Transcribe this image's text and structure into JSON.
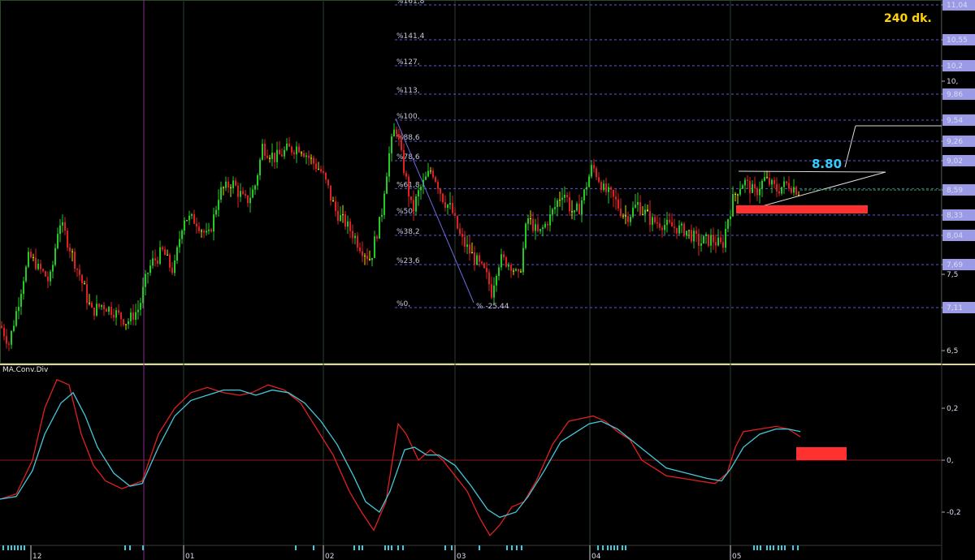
{
  "timeframe_label": "240 dk.",
  "indicator_title": "MA.Conv.Div",
  "annotation_value": "8.80",
  "fib_low_label": "% -25.44",
  "colors": {
    "background": "#000000",
    "up_candle": "#22cc22",
    "down_candle": "#e02020",
    "doji": "#e0e000",
    "fib_line": "#5a5ad8",
    "macd_line": "#e02020",
    "signal_line": "#44c8dc",
    "highlight_box": "#ff3030",
    "axis_label_bg": "#9a9ae6",
    "current_price_line": "#22bb22",
    "timeframe": "#ffd400",
    "annotation": "#33ccff"
  },
  "chart_data": [
    {
      "type": "candlestick",
      "title": "",
      "y_axis_ticks": [
        "11,04",
        "10,55",
        "10,2",
        "10,",
        "9,86",
        "9,54",
        "9,26",
        "9,02",
        "8,59",
        "8,33",
        "8,04",
        "7,69",
        "7,5",
        "7,11",
        "6,5"
      ],
      "y_axis_values": [
        11.04,
        10.55,
        10.2,
        10.0,
        9.86,
        9.54,
        9.26,
        9.02,
        8.59,
        8.33,
        8.04,
        7.69,
        7.5,
        7.11,
        6.5
      ],
      "ylim": [
        6.4,
        11.1
      ],
      "x_axis_labels": [
        "12",
        "01",
        "02",
        "03",
        "04",
        "05"
      ],
      "current_price": 8.59,
      "fibonacci_levels": [
        {
          "label": "%161,8",
          "price": 11.04
        },
        {
          "label": "%141,4",
          "price": 10.55
        },
        {
          "label": "%127,",
          "price": 10.2
        },
        {
          "label": "%113,",
          "price": 9.86
        },
        {
          "label": "%100,",
          "price": 9.54
        },
        {
          "label": "%88,6",
          "price": 9.26
        },
        {
          "label": "%78,6",
          "price": 9.02
        },
        {
          "label": "%61,8",
          "price": 8.61
        },
        {
          "label": "%50,",
          "price": 8.33
        },
        {
          "label": "%38,2",
          "price": 8.04
        },
        {
          "label": "%23,6",
          "price": 7.69
        },
        {
          "label": "%0,",
          "price": 7.11
        }
      ],
      "price_path": [
        [
          0,
          6.85
        ],
        [
          10,
          6.6
        ],
        [
          22,
          7.2
        ],
        [
          35,
          7.8
        ],
        [
          48,
          7.6
        ],
        [
          60,
          7.4
        ],
        [
          72,
          8.25
        ],
        [
          85,
          7.9
        ],
        [
          100,
          7.4
        ],
        [
          112,
          7.05
        ],
        [
          125,
          7.15
        ],
        [
          140,
          7.05
        ],
        [
          155,
          6.9
        ],
        [
          170,
          7.1
        ],
        [
          185,
          7.7
        ],
        [
          200,
          7.85
        ],
        [
          212,
          7.55
        ],
        [
          225,
          8.3
        ],
        [
          240,
          8.25
        ],
        [
          255,
          8.0
        ],
        [
          268,
          8.55
        ],
        [
          285,
          8.7
        ],
        [
          300,
          8.45
        ],
        [
          312,
          8.6
        ],
        [
          322,
          9.2
        ],
        [
          338,
          9.05
        ],
        [
          352,
          9.15
        ],
        [
          368,
          9.2
        ],
        [
          380,
          9.05
        ],
        [
          395,
          8.85
        ],
        [
          410,
          8.4
        ],
        [
          425,
          8.2
        ],
        [
          440,
          7.95
        ],
        [
          455,
          7.75
        ],
        [
          468,
          8.3
        ],
        [
          478,
          9.1
        ],
        [
          486,
          9.48
        ],
        [
          495,
          8.95
        ],
        [
          506,
          8.35
        ],
        [
          518,
          8.65
        ],
        [
          530,
          8.9
        ],
        [
          542,
          8.55
        ],
        [
          556,
          8.35
        ],
        [
          566,
          8.0
        ],
        [
          580,
          7.8
        ],
        [
          594,
          7.6
        ],
        [
          604,
          7.3
        ],
        [
          614,
          7.75
        ],
        [
          626,
          7.7
        ],
        [
          638,
          7.45
        ],
        [
          648,
          8.3
        ],
        [
          662,
          8.05
        ],
        [
          676,
          8.3
        ],
        [
          692,
          8.6
        ],
        [
          706,
          8.3
        ],
        [
          718,
          8.55
        ],
        [
          728,
          8.95
        ],
        [
          742,
          8.6
        ],
        [
          758,
          8.45
        ],
        [
          770,
          8.3
        ],
        [
          785,
          8.45
        ],
        [
          800,
          8.25
        ],
        [
          815,
          8.2
        ],
        [
          830,
          8.15
        ],
        [
          845,
          8.1
        ],
        [
          860,
          7.95
        ],
        [
          875,
          8.0
        ],
        [
          888,
          7.9
        ],
        [
          896,
          8.35
        ],
        [
          906,
          8.6
        ],
        [
          915,
          8.72
        ],
        [
          928,
          8.55
        ],
        [
          940,
          8.75
        ],
        [
          955,
          8.6
        ],
        [
          968,
          8.68
        ],
        [
          982,
          8.59
        ]
      ],
      "annotations": {
        "resistance_value": "8.80",
        "fib_extension_low": "% -25.44"
      }
    },
    {
      "type": "line",
      "title": "MA.Conv.Div",
      "y_axis_ticks": [
        "0,2",
        "0,",
        "-0,2"
      ],
      "y_axis_values": [
        0.2,
        0.0,
        -0.2
      ],
      "ylim": [
        -0.32,
        0.36
      ],
      "series": [
        {
          "name": "",
          "role": "macd",
          "points": [
            [
              0,
              -0.15
            ],
            [
              20,
              -0.13
            ],
            [
              40,
              0.0
            ],
            [
              55,
              0.2
            ],
            [
              70,
              0.31
            ],
            [
              85,
              0.29
            ],
            [
              100,
              0.1
            ],
            [
              115,
              -0.02
            ],
            [
              130,
              -0.08
            ],
            [
              150,
              -0.11
            ],
            [
              175,
              -0.08
            ],
            [
              195,
              0.1
            ],
            [
              215,
              0.2
            ],
            [
              235,
              0.26
            ],
            [
              255,
              0.28
            ],
            [
              275,
              0.26
            ],
            [
              295,
              0.25
            ],
            [
              310,
              0.26
            ],
            [
              330,
              0.29
            ],
            [
              350,
              0.27
            ],
            [
              370,
              0.22
            ],
            [
              390,
              0.12
            ],
            [
              410,
              0.02
            ],
            [
              430,
              -0.12
            ],
            [
              445,
              -0.2
            ],
            [
              460,
              -0.27
            ],
            [
              475,
              -0.16
            ],
            [
              490,
              0.14
            ],
            [
              500,
              0.1
            ],
            [
              515,
              0.0
            ],
            [
              530,
              0.04
            ],
            [
              545,
              0.0
            ],
            [
              560,
              -0.06
            ],
            [
              575,
              -0.12
            ],
            [
              590,
              -0.22
            ],
            [
              603,
              -0.29
            ],
            [
              615,
              -0.25
            ],
            [
              630,
              -0.18
            ],
            [
              645,
              -0.16
            ],
            [
              660,
              -0.08
            ],
            [
              680,
              0.06
            ],
            [
              700,
              0.15
            ],
            [
              715,
              0.16
            ],
            [
              730,
              0.17
            ],
            [
              745,
              0.15
            ],
            [
              760,
              0.11
            ],
            [
              775,
              0.08
            ],
            [
              790,
              0.0
            ],
            [
              805,
              -0.03
            ],
            [
              820,
              -0.06
            ],
            [
              840,
              -0.07
            ],
            [
              860,
              -0.08
            ],
            [
              880,
              -0.09
            ],
            [
              895,
              -0.05
            ],
            [
              905,
              0.05
            ],
            [
              915,
              0.11
            ],
            [
              935,
              0.12
            ],
            [
              955,
              0.13
            ],
            [
              970,
              0.12
            ],
            [
              985,
              0.09
            ]
          ]
        },
        {
          "name": "",
          "role": "signal",
          "points": [
            [
              0,
              -0.15
            ],
            [
              20,
              -0.14
            ],
            [
              40,
              -0.04
            ],
            [
              55,
              0.1
            ],
            [
              75,
              0.22
            ],
            [
              90,
              0.26
            ],
            [
              105,
              0.17
            ],
            [
              120,
              0.05
            ],
            [
              140,
              -0.05
            ],
            [
              160,
              -0.1
            ],
            [
              175,
              -0.09
            ],
            [
              195,
              0.05
            ],
            [
              215,
              0.17
            ],
            [
              235,
              0.23
            ],
            [
              255,
              0.25
            ],
            [
              275,
              0.27
            ],
            [
              295,
              0.27
            ],
            [
              315,
              0.25
            ],
            [
              335,
              0.27
            ],
            [
              355,
              0.26
            ],
            [
              375,
              0.22
            ],
            [
              395,
              0.15
            ],
            [
              415,
              0.06
            ],
            [
              435,
              -0.06
            ],
            [
              450,
              -0.16
            ],
            [
              467,
              -0.2
            ],
            [
              480,
              -0.12
            ],
            [
              498,
              0.04
            ],
            [
              510,
              0.05
            ],
            [
              525,
              0.02
            ],
            [
              540,
              0.02
            ],
            [
              560,
              -0.02
            ],
            [
              580,
              -0.1
            ],
            [
              600,
              -0.19
            ],
            [
              615,
              -0.22
            ],
            [
              635,
              -0.2
            ],
            [
              650,
              -0.14
            ],
            [
              670,
              -0.04
            ],
            [
              690,
              0.07
            ],
            [
              710,
              0.11
            ],
            [
              725,
              0.14
            ],
            [
              740,
              0.15
            ],
            [
              760,
              0.12
            ],
            [
              780,
              0.07
            ],
            [
              800,
              0.02
            ],
            [
              820,
              -0.03
            ],
            [
              845,
              -0.05
            ],
            [
              870,
              -0.07
            ],
            [
              888,
              -0.08
            ],
            [
              900,
              -0.03
            ],
            [
              915,
              0.05
            ],
            [
              935,
              0.1
            ],
            [
              955,
              0.12
            ],
            [
              970,
              0.12
            ],
            [
              985,
              0.11
            ]
          ]
        }
      ]
    }
  ]
}
